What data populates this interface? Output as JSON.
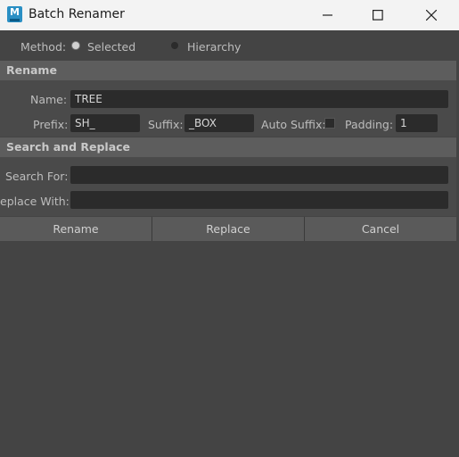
{
  "window": {
    "title": "Batch Renamer",
    "icon_letter": "M",
    "controls": [
      "minimize",
      "maximize",
      "close"
    ]
  },
  "method": {
    "label": "Method:",
    "options": [
      {
        "label": "Selected",
        "checked": true
      },
      {
        "label": "Hierarchy",
        "checked": false
      }
    ]
  },
  "rename": {
    "header": "Rename",
    "name_label": "Name:",
    "name_value": "TREE",
    "prefix_label": "Prefix:",
    "prefix_value": "SH_",
    "suffix_label": "Suffix:",
    "suffix_value": "_BOX",
    "auto_suffix_label": "Auto Suffix:",
    "auto_suffix_checked": false,
    "padding_label": "Padding:",
    "padding_value": "1"
  },
  "search_replace": {
    "header": "Search and Replace",
    "search_label": "Search For:",
    "search_value": "",
    "replace_label": "eplace With:",
    "replace_value": ""
  },
  "buttons": {
    "rename": "Rename",
    "replace": "Replace",
    "cancel": "Cancel"
  }
}
